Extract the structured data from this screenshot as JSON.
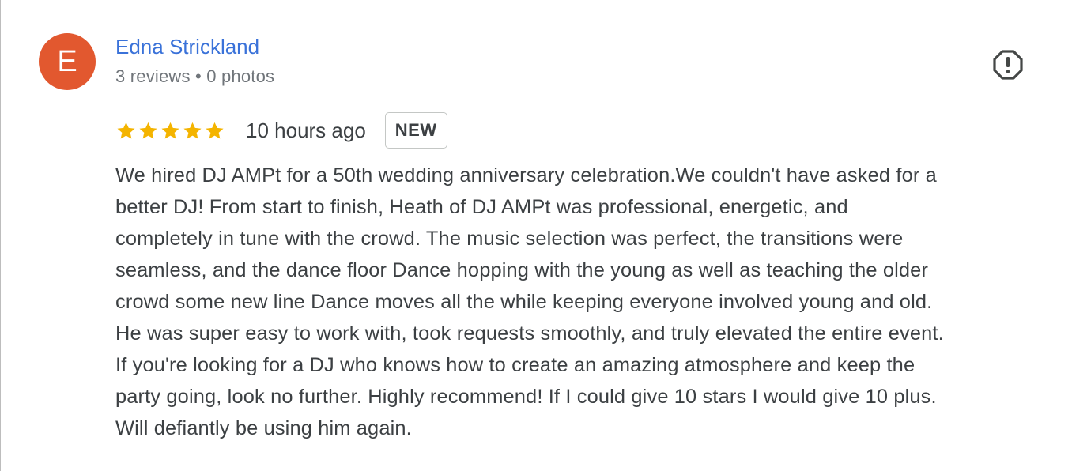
{
  "reviewer": {
    "avatar_letter": "E",
    "avatar_color": "#e2582f",
    "name": "Edna Strickland",
    "name_color": "#3a72d9",
    "meta": "3 reviews • 0 photos"
  },
  "report": {
    "icon": "report-flag-icon"
  },
  "rating": {
    "stars": 5,
    "max_stars": 5,
    "star_color": "#f4b400",
    "timestamp": "10 hours ago",
    "badge": "NEW"
  },
  "review": {
    "lines": [
      "We hired DJ AMPt for a 50th wedding anniversary celebration.We couldn't have asked for a",
      "better DJ! From start to finish, Heath of DJ AMPt was professional, energetic, and",
      "completely in tune with the crowd. The music selection was perfect, the transitions were",
      "seamless, and the dance floor Dance hopping with the young as well as teaching the older",
      "crowd some new line Dance moves all the while keeping everyone involved young and old.",
      "He was super easy to work with, took requests smoothly, and truly elevated the entire event.",
      "If you're looking for a DJ who knows how to create an amazing atmosphere and keep the",
      "party going, look no further. Highly recommend! If I could give 10 stars I would give 10 plus.",
      "Will defiantly be using him again."
    ]
  }
}
